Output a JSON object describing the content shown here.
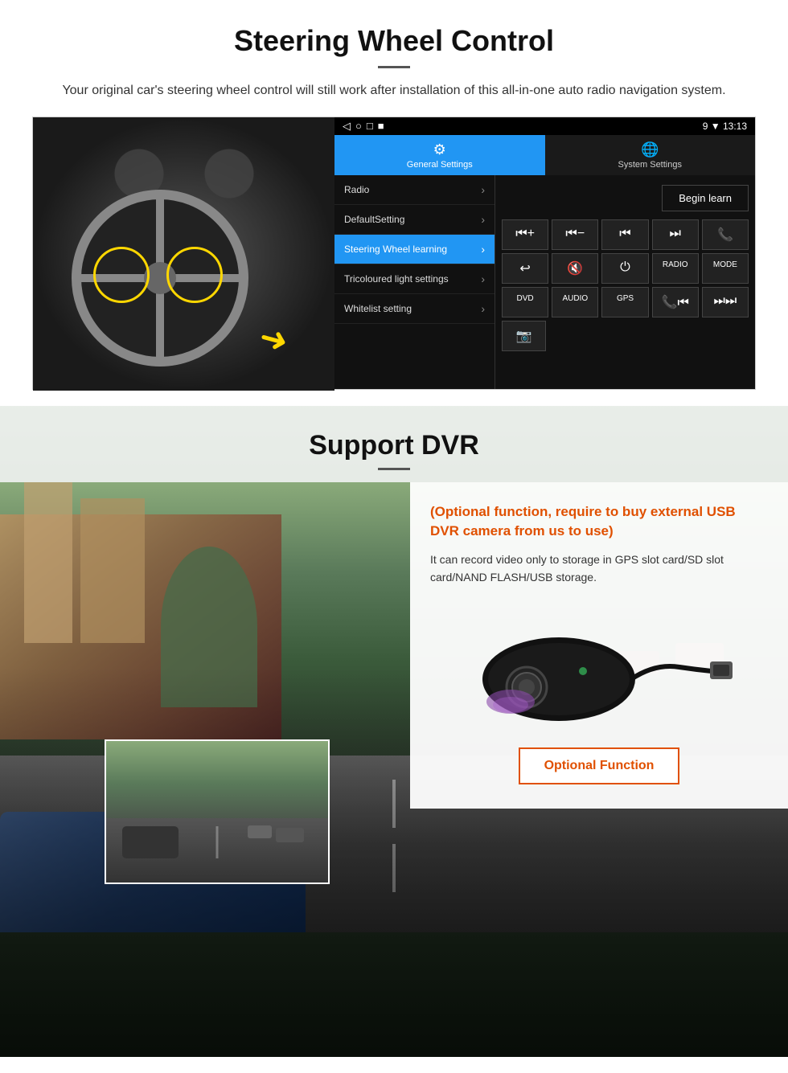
{
  "page": {
    "steering_section": {
      "title": "Steering Wheel Control",
      "subtitle": "Your original car's steering wheel control will still work after installation of this all-in-one auto radio navigation system.",
      "android_ui": {
        "statusbar": {
          "icons": [
            "◁",
            "○",
            "□",
            "■"
          ],
          "right": "9 ▼ 13:13"
        },
        "tabs": [
          {
            "id": "general",
            "label": "General Settings",
            "icon": "⚙",
            "active": true
          },
          {
            "id": "system",
            "label": "System Settings",
            "icon": "🌐",
            "active": false
          }
        ],
        "menu_items": [
          {
            "label": "Radio",
            "active": false
          },
          {
            "label": "DefaultSetting",
            "active": false
          },
          {
            "label": "Steering Wheel learning",
            "active": true
          },
          {
            "label": "Tricoloured light settings",
            "active": false
          },
          {
            "label": "Whitelist setting",
            "active": false
          }
        ],
        "begin_learn_button": "Begin learn",
        "control_buttons": [
          [
            "⏮+",
            "⏮−",
            "⏮⏮",
            "⏭⏭",
            "📞"
          ],
          [
            "↩",
            "🔇×",
            "⏻",
            "RADIO",
            "MODE"
          ],
          [
            "DVD",
            "AUDIO",
            "GPS",
            "📞⏮",
            "⏭⏭"
          ]
        ]
      }
    },
    "dvr_section": {
      "title": "Support DVR",
      "info_box": {
        "optional_text": "(Optional function, require to buy external USB DVR camera from us to use)",
        "description": "It can record video only to storage in GPS slot card/SD slot card/NAND FLASH/USB storage.",
        "optional_function_btn": "Optional Function"
      }
    }
  }
}
